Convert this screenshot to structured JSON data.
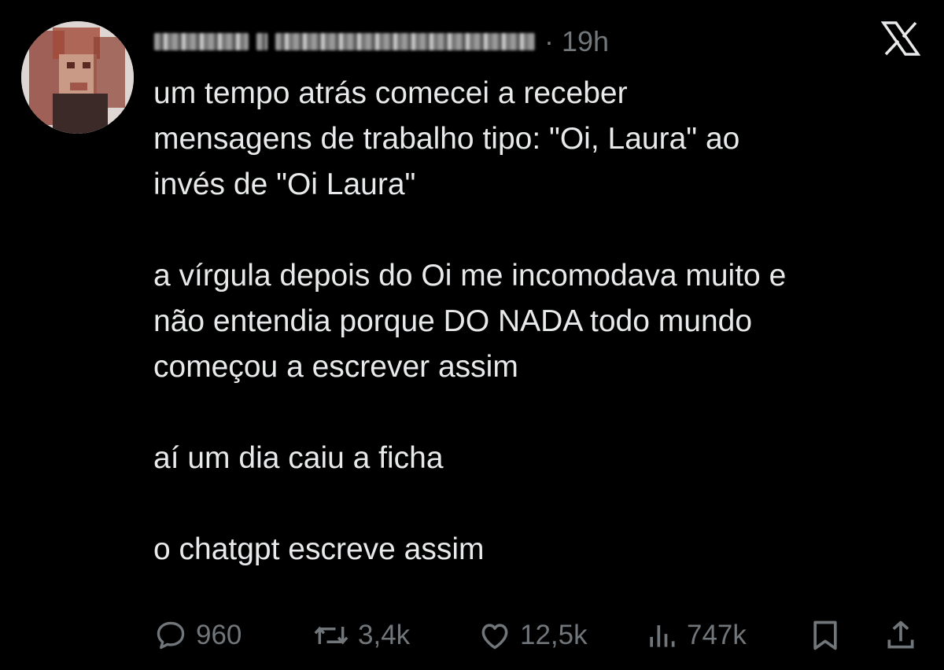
{
  "tweet": {
    "time": "19h",
    "paragraphs": [
      [
        "um tempo atrás comecei a receber",
        "mensagens de trabalho tipo: \"Oi, Laura\" ao",
        "invés de \"Oi Laura\""
      ],
      [
        "a vírgula depois do Oi me incomodava muito e",
        "não entendia porque DO NADA todo mundo",
        "começou a escrever assim"
      ],
      [
        "aí um dia caiu a ficha"
      ],
      [
        "o chatgpt escreve assim"
      ]
    ]
  },
  "actions": {
    "replies": "960",
    "reposts": "3,4k",
    "likes": "12,5k",
    "views": "747k"
  },
  "icons": {
    "reply": "reply-icon",
    "repost": "repost-icon",
    "like": "like-icon",
    "views": "views-icon",
    "bookmark": "bookmark-icon",
    "share": "share-icon",
    "brand": "x-logo-icon"
  },
  "colors": {
    "background": "#000000",
    "text": "#e7e9ea",
    "muted": "#71767b"
  }
}
